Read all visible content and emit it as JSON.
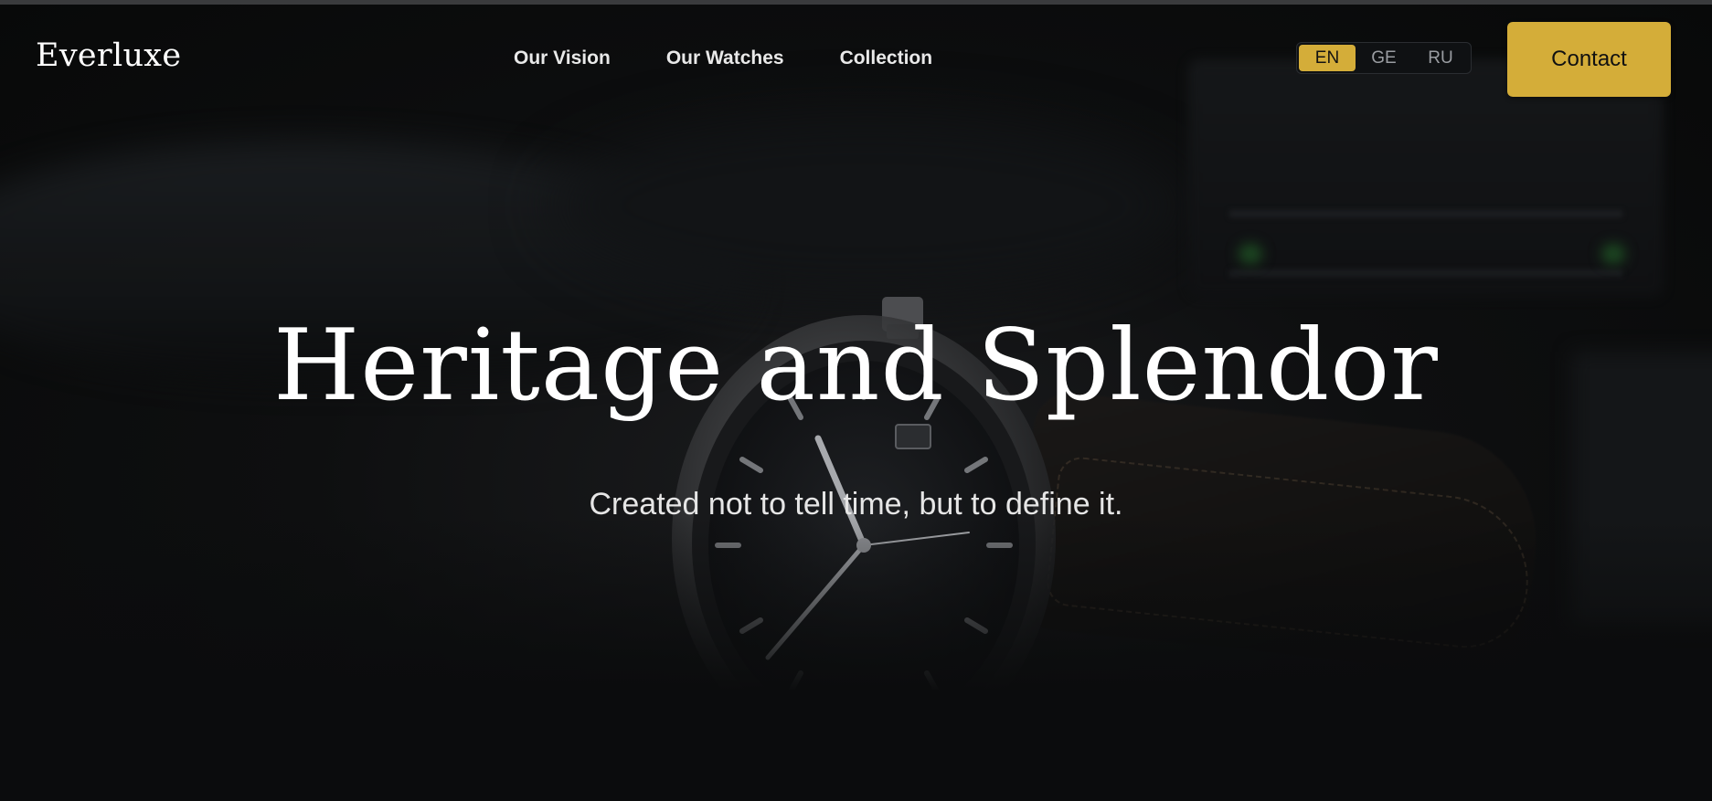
{
  "brand": {
    "logo_text": "Everluxe"
  },
  "nav": {
    "links": [
      {
        "label": "Our Vision"
      },
      {
        "label": "Our Watches"
      },
      {
        "label": "Collection"
      }
    ]
  },
  "language_switcher": {
    "options": [
      "EN",
      "GE",
      "RU"
    ],
    "selected": "EN"
  },
  "contact_button": {
    "label": "Contact"
  },
  "hero": {
    "title": "Heritage and Splendor",
    "subtitle": "Created not to tell time, but to define it."
  },
  "colors": {
    "accent": "#d4ad39",
    "background": "#0a0b0c",
    "text": "#ffffff"
  }
}
